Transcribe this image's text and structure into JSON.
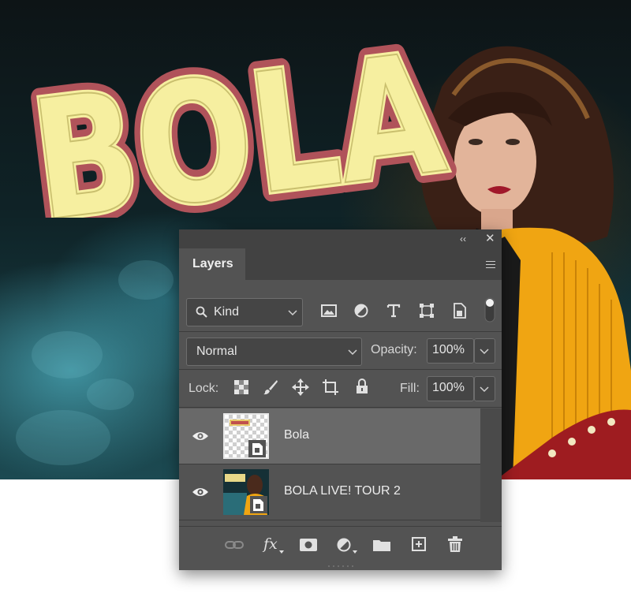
{
  "artwork": {
    "logo_text": "BOLA"
  },
  "panel": {
    "collapse_glyph": "‹‹",
    "close_glyph": "✕",
    "tab_label": "Layers",
    "filter": {
      "value": "Kind"
    },
    "blend_mode": {
      "value": "Normal"
    },
    "opacity": {
      "label": "Opacity:",
      "value": "100%"
    },
    "lock": {
      "label": "Lock:"
    },
    "fill": {
      "label": "Fill:",
      "value": "100%"
    },
    "filter_icons": [
      "image-filter-icon",
      "adjustment-filter-icon",
      "type-filter-icon",
      "shape-filter-icon",
      "smart-object-filter-icon",
      "filter-toggle-icon"
    ],
    "lock_icons": [
      "lock-transparent-pixels-icon",
      "lock-image-pixels-icon",
      "lock-position-icon",
      "lock-artboard-icon",
      "lock-all-icon"
    ],
    "layers": [
      {
        "name": "Bola",
        "selected": true,
        "visible": true,
        "thumb": "transparent-checker-smart-object"
      },
      {
        "name": "BOLA LIVE! TOUR 2",
        "selected": false,
        "visible": true,
        "thumb": "photo-smart-object"
      }
    ],
    "footer_icons": [
      "link-layers-icon",
      "fx-icon",
      "add-mask-icon",
      "new-adjustment-icon",
      "new-group-icon",
      "new-layer-icon",
      "delete-layer-icon"
    ],
    "fx_text": "fx"
  },
  "colors": {
    "panel_bg": "#535353",
    "panel_dark": "#424242",
    "selected_row": "#696969",
    "logo_fill": "#f6efa0",
    "logo_outline": "#b0535a",
    "jacket": "#f0a512"
  }
}
